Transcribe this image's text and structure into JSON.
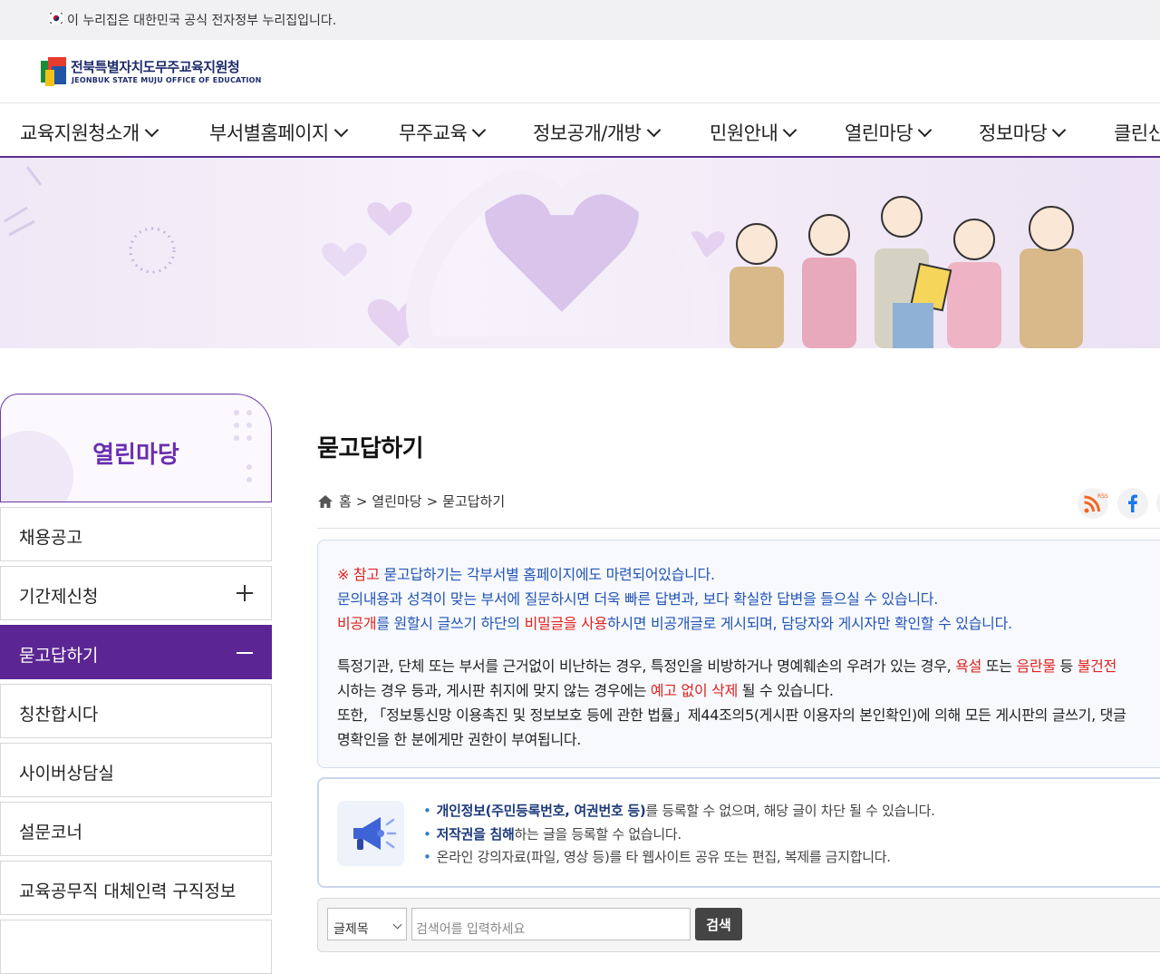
{
  "topbar": {
    "text": "이 누리집은 대한민국 공식 전자정부 누리집입니다."
  },
  "logo": {
    "name_kr": "전북특별자치도무주교육지원청",
    "name_en": "JEONBUK STATE MUJU OFFICE OF EDUCATION"
  },
  "gnb": [
    "교육지원청소개",
    "부서별홈페이지",
    "무주교육",
    "정보공개/개방",
    "민원안내",
    "열린마당",
    "정보마당",
    "클린신"
  ],
  "lnb": {
    "title": "열린마당",
    "items": [
      "채용공고",
      "기간제신청",
      "묻고답하기",
      "칭찬합시다",
      "사이버상담실",
      "설문코너",
      "교육공무직 대체인력 구직정보"
    ]
  },
  "main": {
    "title": "묻고답하기",
    "breadcrumb": [
      "홈",
      ">",
      "열린마당",
      ">",
      "묻고답하기"
    ],
    "rss_label": "RSS"
  },
  "notice": {
    "line1_mark": "※ 참고",
    "line1_text": " 묻고답하기는 각부서별 홈페이지에도 마련되어있습니다.",
    "line2": "문의내용과 성격이 맞는 부서에 질문하시면 더욱 빠른 답변과, 보다 확실한 답변을 들으실 수 있습니다.",
    "line3_a": "비공개",
    "line3_b": "를 원할시 글쓰기 하단의 ",
    "line3_c": "비밀글을 사용",
    "line3_d": "하시면 비공개글로 게시되며, 담당자와 게시자만 확인할 수 있습니다.",
    "line4_a": "특정기관, 단체 또는 부서를 근거없이 비난하는 경우, 특정인을 비방하거나 명예훼손의 우려가 있는 경우, ",
    "line4_b": "욕설",
    "line4_c": " 또는 ",
    "line4_d": "음란물",
    "line4_e": " 등 ",
    "line4_f": "불건전",
    "line5_a": "시하는 경우 등과, 게시판 취지에 맞지 않는 경우에는 ",
    "line5_b": "예고 없이 삭제",
    "line5_c": " 될 수 있습니다.",
    "line6": "또한, 「정보통신망 이용촉진 및 정보보호 등에 관한 법률」제44조의5(게시판 이용자의 본인확인)에 의해 모든 게시판의 글쓰기, 댓글",
    "line7": "명확인을 한 분에게만 권한이 부여됩니다."
  },
  "info": {
    "line1_b": "개인정보(주민등록번호, 여권번호 등)",
    "line1_t": "를 등록할 수 없으며, 해당 글이 차단 될 수 있습니다.",
    "line2_b": "저작권을 침해",
    "line2_t": "하는 글을 등록할 수 없습니다.",
    "line3_t": "온라인 강의자료(파일, 영상 등)를 타 웹사이트 공유 또는 편집, 복제를 금지합니다."
  },
  "search": {
    "select_value": "글제목",
    "placeholder": "검색어를 입력하세요",
    "button": "검색"
  },
  "colors": {
    "accent": "#5b2693",
    "notice_blue": "#2255b5",
    "notice_red": "#e0231f"
  }
}
